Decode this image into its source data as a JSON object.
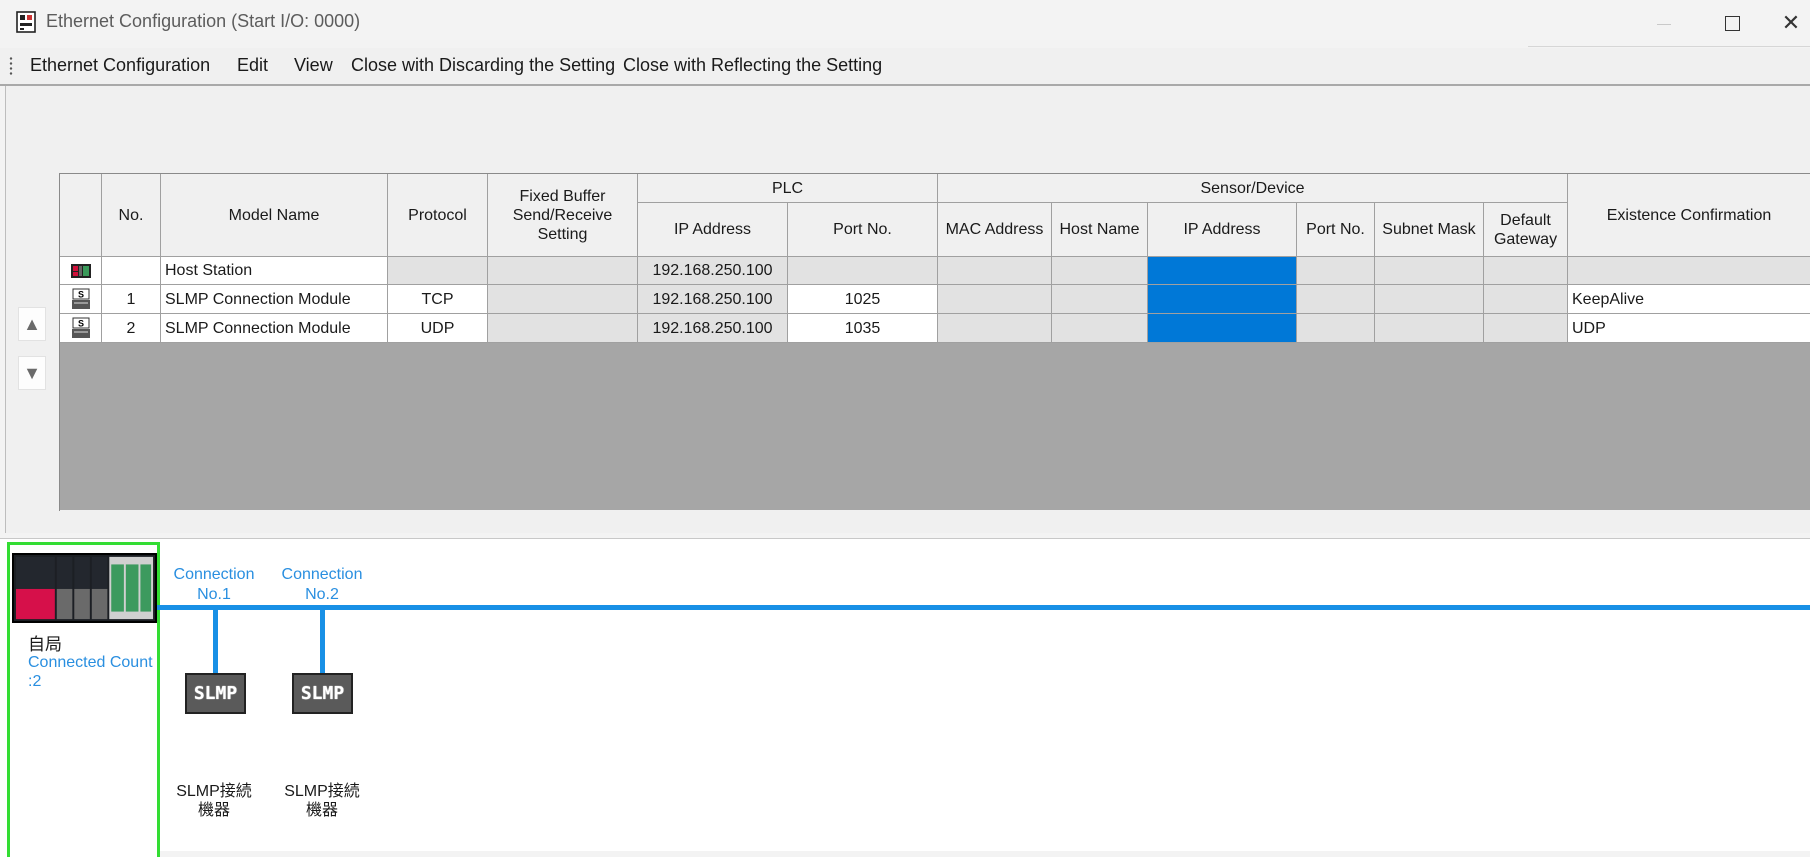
{
  "window": {
    "title": "Ethernet Configuration (Start I/O: 0000)"
  },
  "menu": [
    "Ethernet Configuration",
    "Edit",
    "View",
    "Close with Discarding the Setting",
    "Close with Reflecting the Setting"
  ],
  "table": {
    "headers": {
      "no": "No.",
      "model_name": "Model Name",
      "protocol": "Protocol",
      "fixed_buffer": "Fixed Buffer Send/Receive Setting",
      "plc_group": "PLC",
      "plc_ip": "IP Address",
      "plc_port": "Port No.",
      "sensor_group": "Sensor/Device",
      "mac": "MAC Address",
      "host_name": "Host Name",
      "dev_ip": "IP Address",
      "dev_port": "Port No.",
      "subnet": "Subnet Mask",
      "gateway": "Default Gateway",
      "existence": "Existence Confirmation"
    },
    "rows": [
      {
        "icon": "host-station-icon",
        "no": "",
        "model_name": "Host Station",
        "protocol": "",
        "plc_ip": "192.168.250.100",
        "plc_port": "",
        "existence": ""
      },
      {
        "icon": "slmp-device-icon",
        "no": "1",
        "model_name": "SLMP Connection Module",
        "protocol": "TCP",
        "plc_ip": "192.168.250.100",
        "plc_port": "1025",
        "existence": "KeepAlive"
      },
      {
        "icon": "slmp-device-icon",
        "no": "2",
        "model_name": "SLMP Connection Module",
        "protocol": "UDP",
        "plc_ip": "192.168.250.100",
        "plc_port": "1035",
        "existence": "UDP"
      }
    ]
  },
  "diagram": {
    "host": {
      "name": "自局",
      "count": "Connected Count",
      "count_value": ":2"
    },
    "connections": [
      {
        "label_line1": "Connection",
        "label_line2": "No.1",
        "module": "SLMP",
        "device_line1": "SLMP接続",
        "device_line2": "機器"
      },
      {
        "label_line1": "Connection",
        "label_line2": "No.2",
        "module": "SLMP",
        "device_line1": "SLMP接続",
        "device_line2": "機器"
      }
    ]
  },
  "colors": {
    "selection": "#0078d7",
    "bus": "#1890e6",
    "host_frame": "#33dd33",
    "link_text": "#2a8fe0"
  }
}
